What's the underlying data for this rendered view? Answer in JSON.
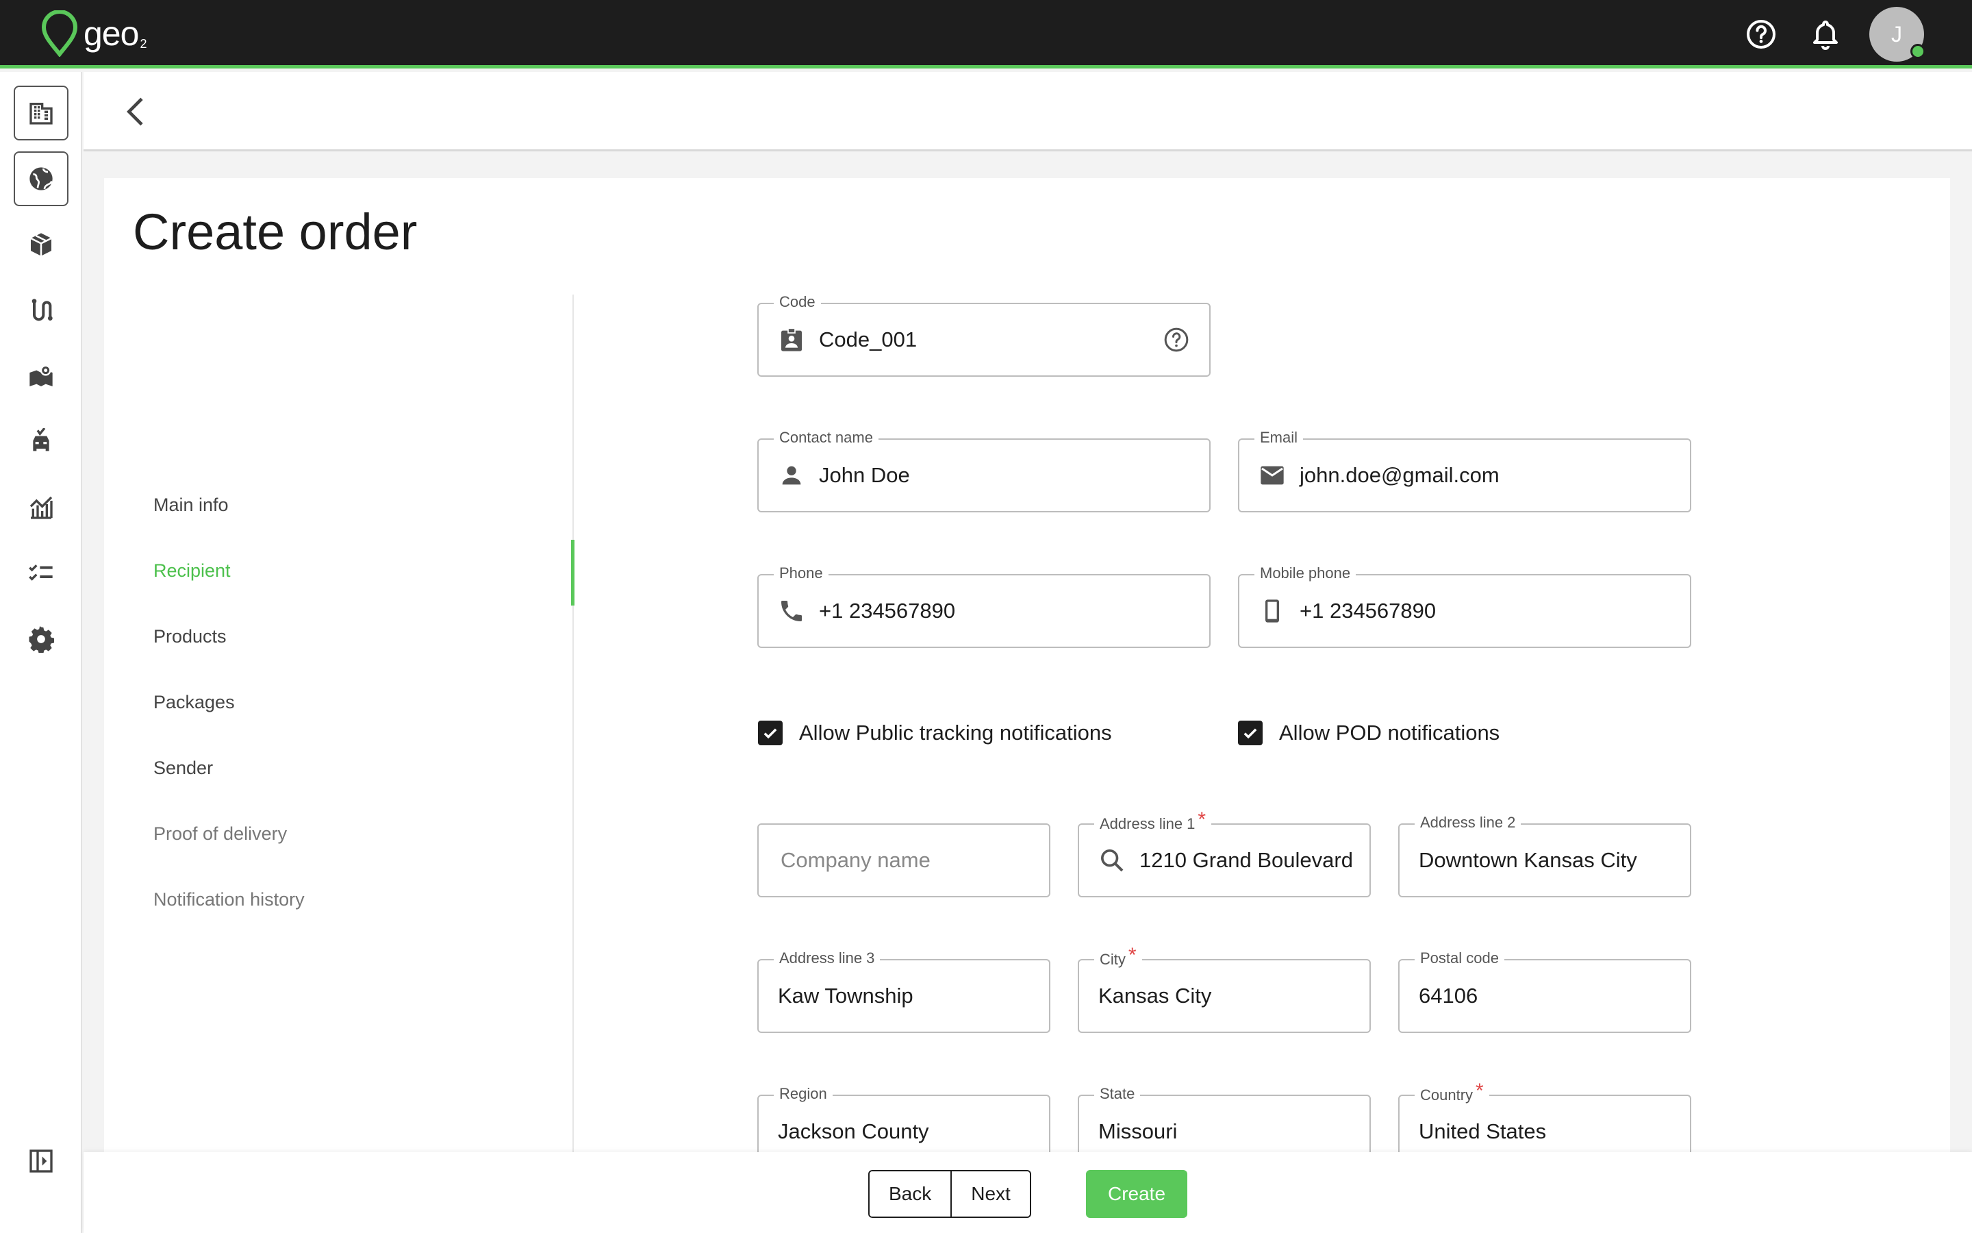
{
  "app": {
    "logo_text": "geo",
    "logo_sub": "2"
  },
  "user": {
    "avatar_initial": "J"
  },
  "page": {
    "title": "Create order"
  },
  "steps": [
    {
      "label": "Main info"
    },
    {
      "label": "Recipient"
    },
    {
      "label": "Products"
    },
    {
      "label": "Packages"
    },
    {
      "label": "Sender"
    },
    {
      "label": "Proof of delivery"
    },
    {
      "label": "Notification history"
    }
  ],
  "form": {
    "code": {
      "label": "Code",
      "value": "Code_001"
    },
    "contact_name": {
      "label": "Contact name",
      "value": "John Doe"
    },
    "email": {
      "label": "Email",
      "value": "john.doe@gmail.com"
    },
    "phone": {
      "label": "Phone",
      "value": "+1 234567890"
    },
    "mobile_phone": {
      "label": "Mobile phone",
      "value": "+1 234567890"
    },
    "allow_public_tracking": {
      "label": "Allow Public tracking notifications",
      "checked": true
    },
    "allow_pod": {
      "label": "Allow POD notifications",
      "checked": true
    },
    "company_name": {
      "placeholder": "Company name"
    },
    "address_line_1": {
      "label": "Address line 1",
      "required_mark": "*",
      "value": "1210 Grand Boulevard"
    },
    "address_line_2": {
      "label": "Address line 2",
      "value": "Downtown Kansas City"
    },
    "address_line_3": {
      "label": "Address line 3",
      "value": "Kaw Township"
    },
    "city": {
      "label": "City",
      "required_mark": "*",
      "value": "Kansas City"
    },
    "postal_code": {
      "label": "Postal code",
      "value": "64106"
    },
    "region": {
      "label": "Region",
      "value": "Jackson County"
    },
    "state": {
      "label": "State",
      "value": "Missouri"
    },
    "country": {
      "label": "Country",
      "required_mark": "*",
      "value": "United States"
    }
  },
  "actions": {
    "back": "Back",
    "next": "Next",
    "create": "Create"
  },
  "icons": {
    "top": [
      "help-icon",
      "bell-icon"
    ],
    "rail": [
      "building-icon",
      "globe-icon",
      "package-icon",
      "route-icon",
      "map-icon",
      "vehicle-icon",
      "analytics-icon",
      "checklist-icon",
      "settings-icon",
      "collapse-sidebar-icon"
    ]
  },
  "colors": {
    "accent": "#5ac85a",
    "topbar": "#1d1d1d",
    "required": "#e04848"
  }
}
